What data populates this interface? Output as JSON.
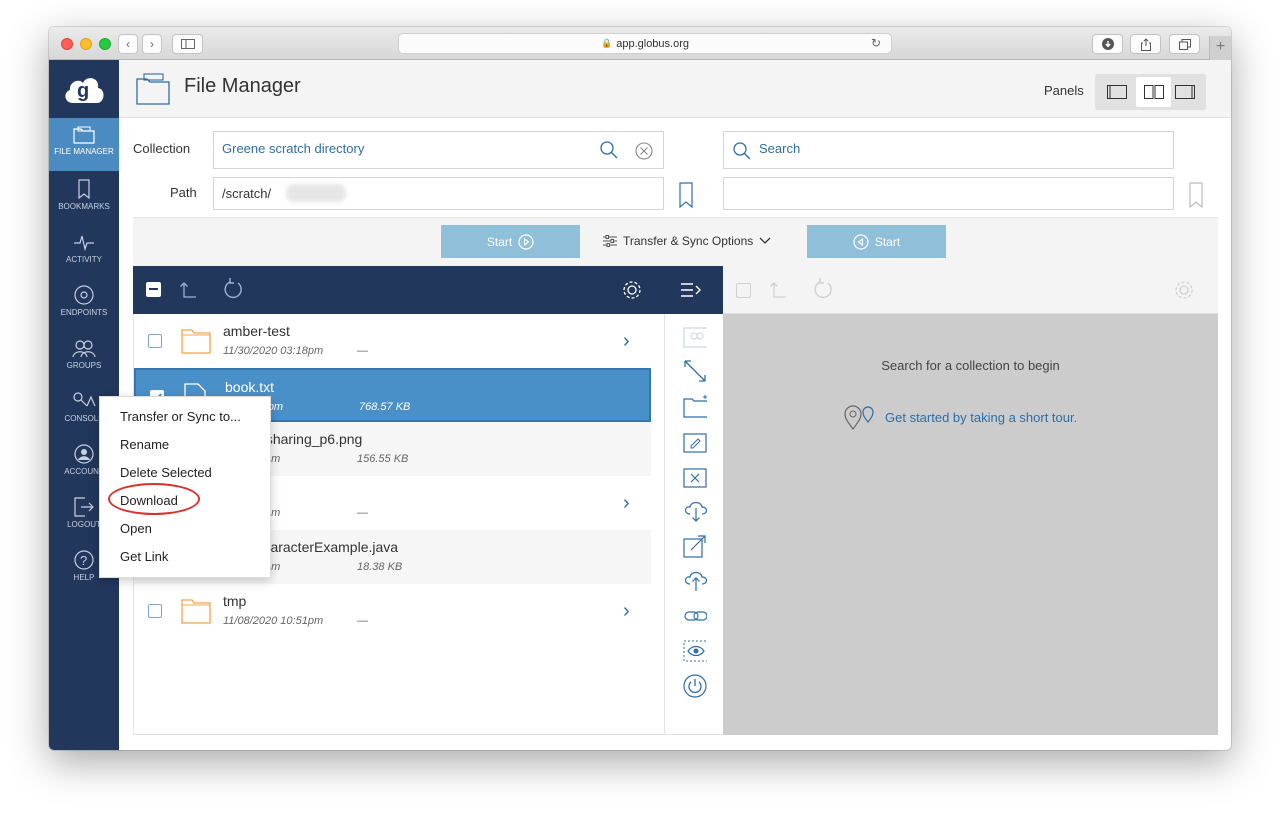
{
  "browser": {
    "url": "app.globus.org",
    "lock_icon": "lock-icon"
  },
  "nav": {
    "items": [
      {
        "label": "FILE MANAGER",
        "icon": "folder-icon"
      },
      {
        "label": "BOOKMARKS",
        "icon": "bookmark-icon"
      },
      {
        "label": "ACTIVITY",
        "icon": "activity-icon"
      },
      {
        "label": "ENDPOINTS",
        "icon": "endpoints-icon"
      },
      {
        "label": "GROUPS",
        "icon": "groups-icon"
      },
      {
        "label": "CONSOLE",
        "icon": "console-icon"
      },
      {
        "label": "ACCOUNT",
        "icon": "account-icon"
      },
      {
        "label": "LOGOUT",
        "icon": "logout-icon"
      },
      {
        "label": "HELP",
        "icon": "help-icon"
      }
    ]
  },
  "header": {
    "title": "File Manager",
    "panels_label": "Panels"
  },
  "left": {
    "collection_label": "Collection",
    "collection_value": "Greene scratch directory",
    "path_label": "Path",
    "path_value": "/scratch/"
  },
  "right": {
    "search_placeholder": "Search",
    "empty_message": "Search for a collection to begin",
    "tour_link": "Get started by taking a short tour."
  },
  "transfer": {
    "start_label": "Start",
    "options_label": "Transfer & Sync Options"
  },
  "files": [
    {
      "name": "amber-test",
      "date": "11/30/2020 03:18pm",
      "size": "—",
      "type": "folder",
      "selected": false
    },
    {
      "name": "book.txt",
      "date": "20 08:34pm",
      "size": "768.57 KB",
      "type": "file",
      "selected": true
    },
    {
      "name": "_data_sharing_p6.png",
      "date": "20 11:09am",
      "size": "156.55 KB",
      "type": "file",
      "selected": false
    },
    {
      "name": "",
      "date": "21 11:10am",
      "size": "—",
      "type": "folder",
      "selected": false
    },
    {
      "name": "STMCharacterExample.java",
      "date": "20 11:30am",
      "size": "18.38 KB",
      "type": "file",
      "selected": false
    },
    {
      "name": "tmp",
      "date": "11/08/2020 10:51pm",
      "size": "—",
      "type": "folder",
      "selected": false
    }
  ],
  "context_menu": {
    "items": [
      "Transfer or Sync to...",
      "Rename",
      "Delete Selected",
      "Download",
      "Open",
      "Get Link"
    ],
    "highlighted": "Download"
  },
  "colors": {
    "nav_bg": "#22375c",
    "accent": "#4a8bc2",
    "selected_row": "#4a90c8",
    "start_button": "#8fbfd9",
    "highlight_ring": "#d9322d",
    "link": "#2d6ea4"
  }
}
